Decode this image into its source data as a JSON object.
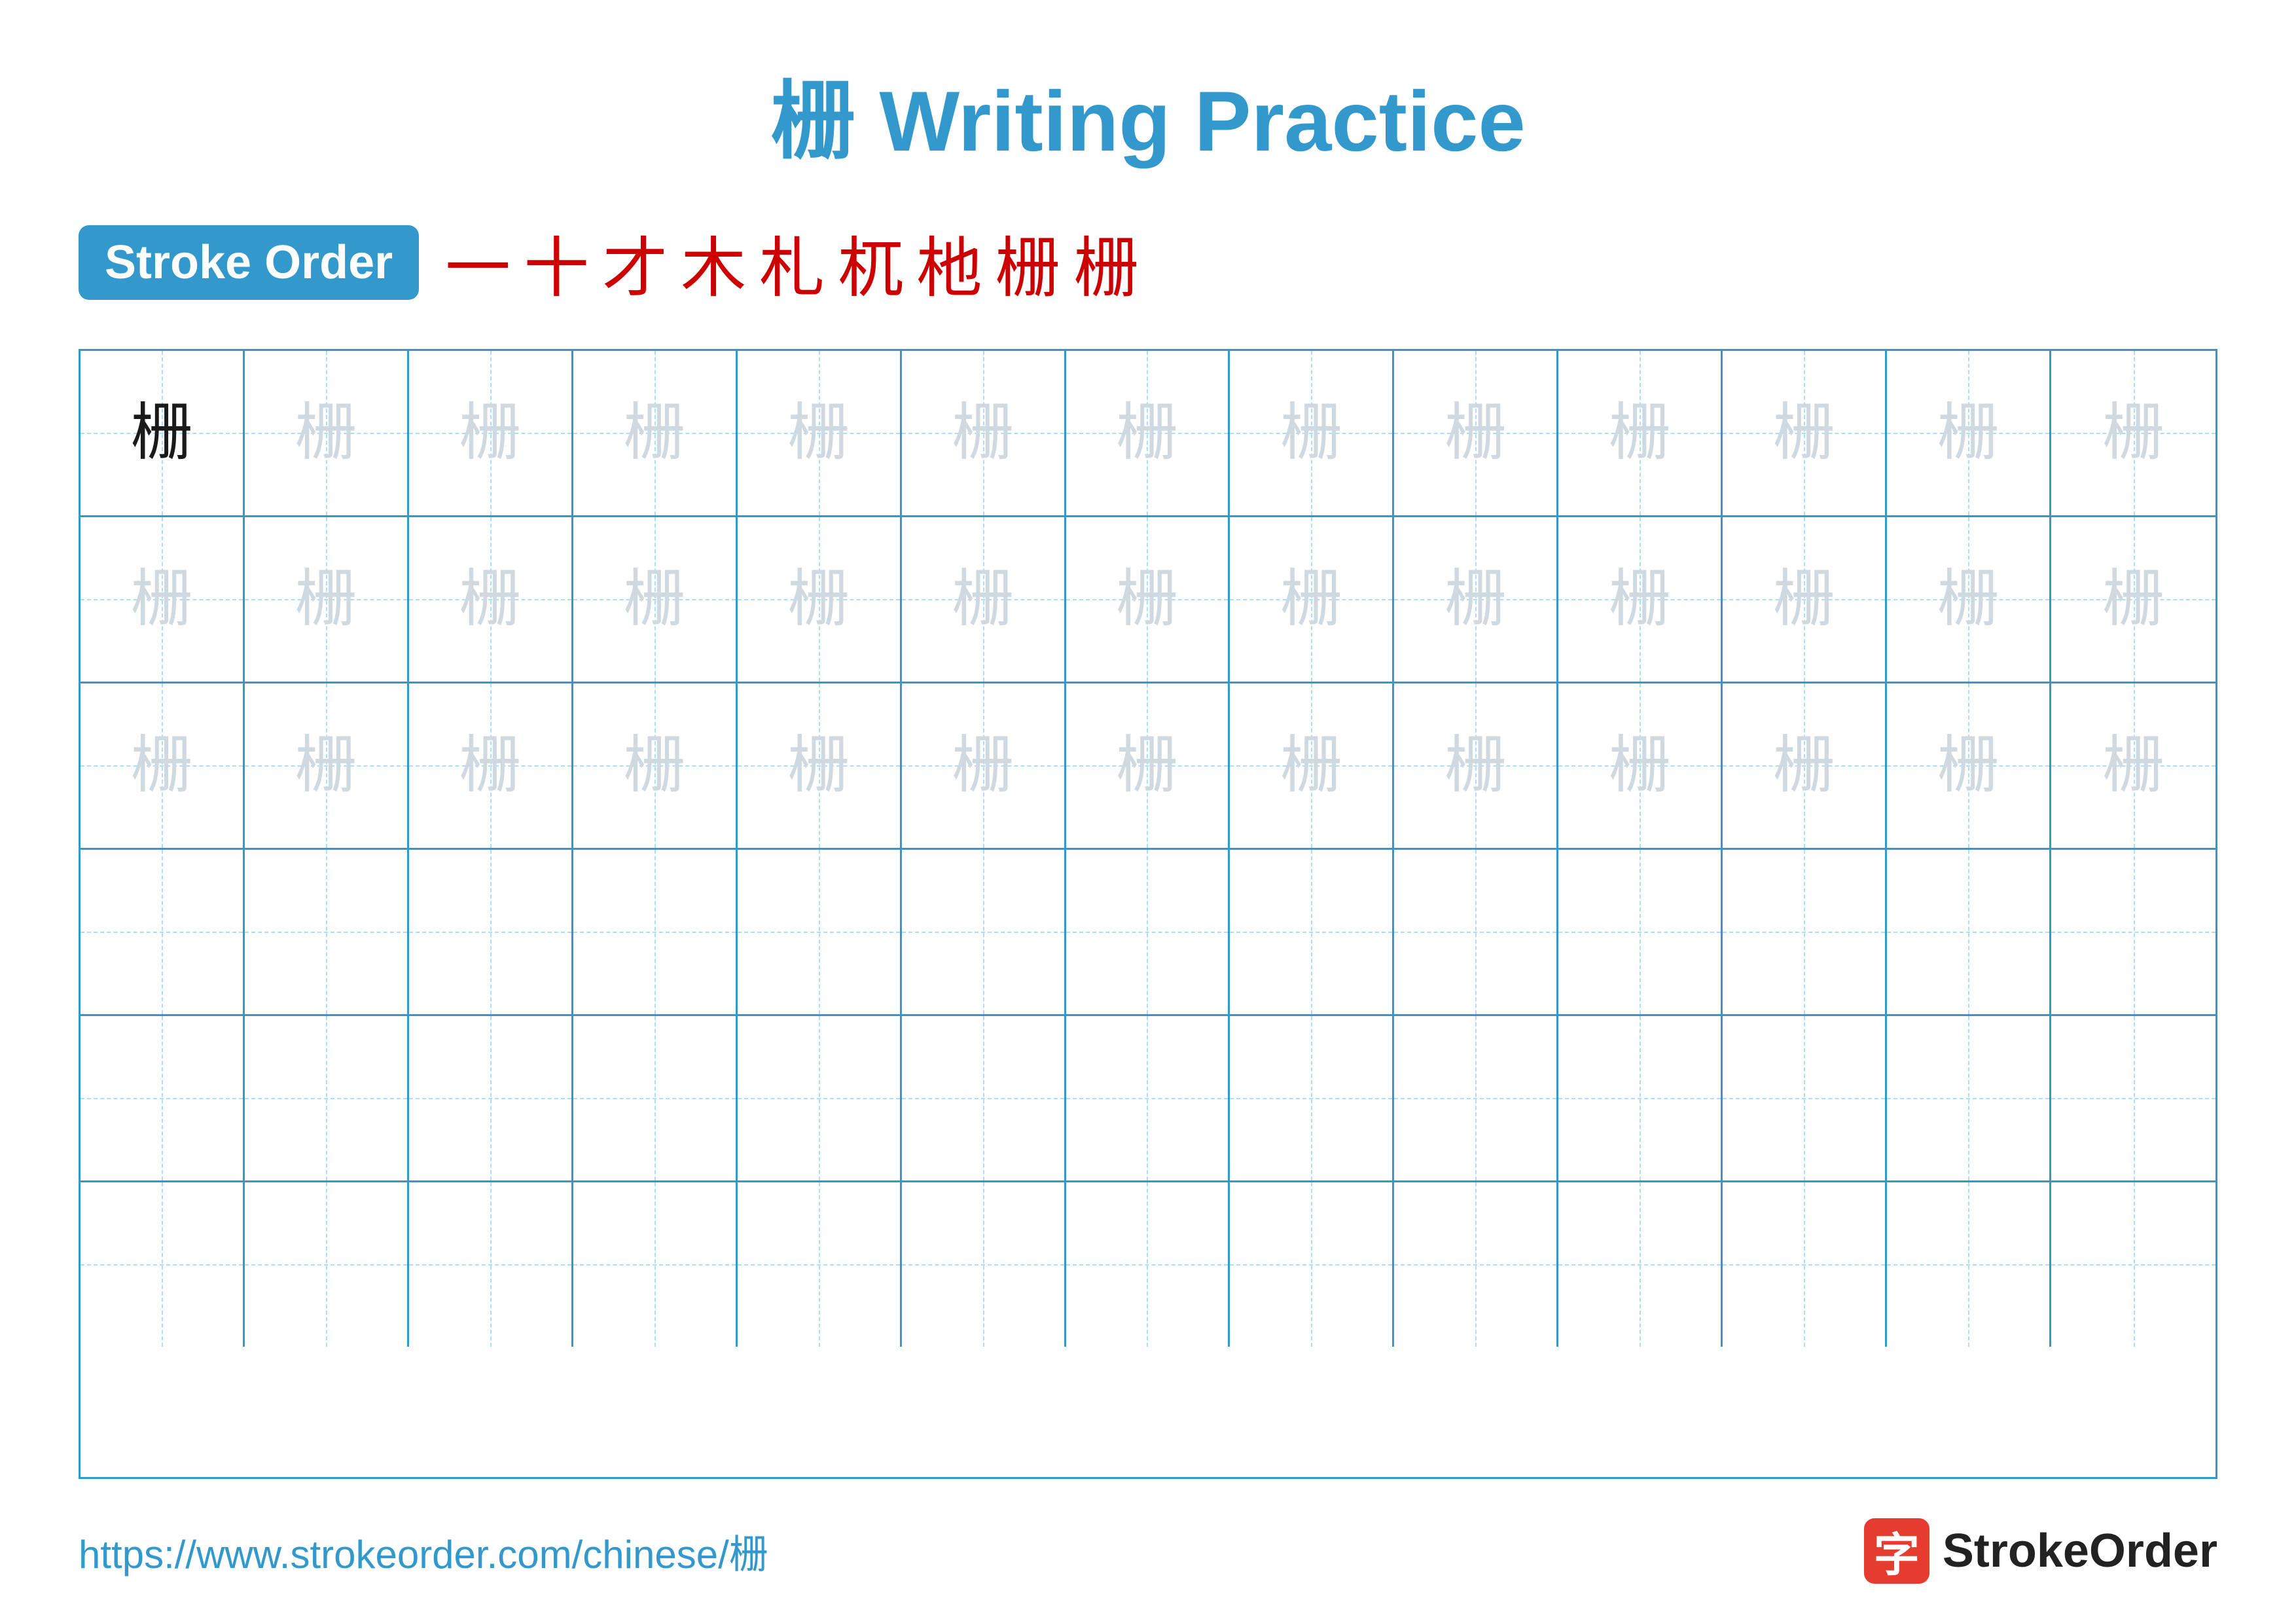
{
  "title": {
    "chinese_char": "栅",
    "english_text": "Writing Practice"
  },
  "stroke_order": {
    "badge_label": "Stroke Order",
    "sequence": [
      "一",
      "十",
      "才",
      "木",
      "札",
      "杌",
      "杝",
      "栅",
      "栅"
    ]
  },
  "grid": {
    "rows": 6,
    "cols": 13,
    "character": "栅",
    "row_configs": [
      {
        "type": "dark_then_light",
        "dark_count": 1
      },
      {
        "type": "all_light"
      },
      {
        "type": "all_light"
      },
      {
        "type": "empty"
      },
      {
        "type": "empty"
      },
      {
        "type": "empty"
      }
    ]
  },
  "footer": {
    "url": "https://www.strokeorder.com/chinese/栅",
    "brand_text": "StrokeOrder",
    "brand_icon": "字"
  }
}
